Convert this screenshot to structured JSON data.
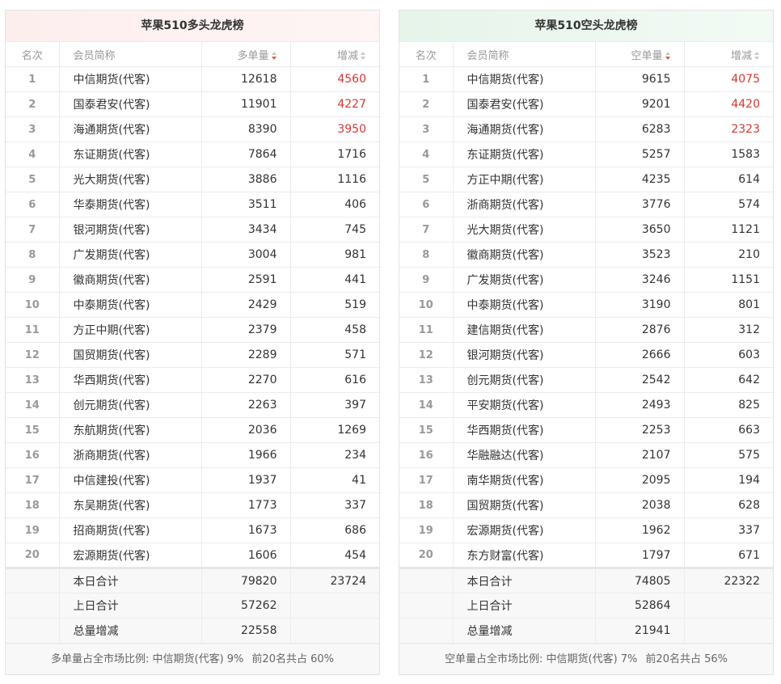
{
  "left": {
    "title": "苹果510多头龙虎榜",
    "headers": {
      "rank": "名次",
      "member": "会员简称",
      "volume": "多单量",
      "change": "增减"
    },
    "rows": [
      {
        "rank": "1",
        "member": "中信期货(代客)",
        "volume": "12618",
        "change": "4560"
      },
      {
        "rank": "2",
        "member": "国泰君安(代客)",
        "volume": "11901",
        "change": "4227"
      },
      {
        "rank": "3",
        "member": "海通期货(代客)",
        "volume": "8390",
        "change": "3950"
      },
      {
        "rank": "4",
        "member": "东证期货(代客)",
        "volume": "7864",
        "change": "1716"
      },
      {
        "rank": "5",
        "member": "光大期货(代客)",
        "volume": "3886",
        "change": "1116"
      },
      {
        "rank": "6",
        "member": "华泰期货(代客)",
        "volume": "3511",
        "change": "406"
      },
      {
        "rank": "7",
        "member": "银河期货(代客)",
        "volume": "3434",
        "change": "745"
      },
      {
        "rank": "8",
        "member": "广发期货(代客)",
        "volume": "3004",
        "change": "981"
      },
      {
        "rank": "9",
        "member": "徽商期货(代客)",
        "volume": "2591",
        "change": "441"
      },
      {
        "rank": "10",
        "member": "中泰期货(代客)",
        "volume": "2429",
        "change": "519"
      },
      {
        "rank": "11",
        "member": "方正中期(代客)",
        "volume": "2379",
        "change": "458"
      },
      {
        "rank": "12",
        "member": "国贸期货(代客)",
        "volume": "2289",
        "change": "571"
      },
      {
        "rank": "13",
        "member": "华西期货(代客)",
        "volume": "2270",
        "change": "616"
      },
      {
        "rank": "14",
        "member": "创元期货(代客)",
        "volume": "2263",
        "change": "397"
      },
      {
        "rank": "15",
        "member": "东航期货(代客)",
        "volume": "2036",
        "change": "1269"
      },
      {
        "rank": "16",
        "member": "浙商期货(代客)",
        "volume": "1966",
        "change": "234"
      },
      {
        "rank": "17",
        "member": "中信建投(代客)",
        "volume": "1937",
        "change": "41"
      },
      {
        "rank": "18",
        "member": "东吴期货(代客)",
        "volume": "1773",
        "change": "337"
      },
      {
        "rank": "19",
        "member": "招商期货(代客)",
        "volume": "1673",
        "change": "686"
      },
      {
        "rank": "20",
        "member": "宏源期货(代客)",
        "volume": "1606",
        "change": "454"
      }
    ],
    "totals": [
      {
        "label": "本日合计",
        "volume": "79820",
        "change": "23724"
      },
      {
        "label": "上日合计",
        "volume": "57262",
        "change": ""
      },
      {
        "label": "总量增减",
        "volume": "22558",
        "change": ""
      }
    ],
    "footer": {
      "ratio": "多单量占全市场比例: 中信期货(代客) 9%",
      "top20": "前20名共占 60%"
    }
  },
  "right": {
    "title": "苹果510空头龙虎榜",
    "headers": {
      "rank": "名次",
      "member": "会员简称",
      "volume": "空单量",
      "change": "增减"
    },
    "rows": [
      {
        "rank": "1",
        "member": "中信期货(代客)",
        "volume": "9615",
        "change": "4075"
      },
      {
        "rank": "2",
        "member": "国泰君安(代客)",
        "volume": "9201",
        "change": "4420"
      },
      {
        "rank": "3",
        "member": "海通期货(代客)",
        "volume": "6283",
        "change": "2323"
      },
      {
        "rank": "4",
        "member": "东证期货(代客)",
        "volume": "5257",
        "change": "1583"
      },
      {
        "rank": "5",
        "member": "方正中期(代客)",
        "volume": "4235",
        "change": "614"
      },
      {
        "rank": "6",
        "member": "浙商期货(代客)",
        "volume": "3776",
        "change": "574"
      },
      {
        "rank": "7",
        "member": "光大期货(代客)",
        "volume": "3650",
        "change": "1121"
      },
      {
        "rank": "8",
        "member": "徽商期货(代客)",
        "volume": "3523",
        "change": "210"
      },
      {
        "rank": "9",
        "member": "广发期货(代客)",
        "volume": "3246",
        "change": "1151"
      },
      {
        "rank": "10",
        "member": "中泰期货(代客)",
        "volume": "3190",
        "change": "801"
      },
      {
        "rank": "11",
        "member": "建信期货(代客)",
        "volume": "2876",
        "change": "312"
      },
      {
        "rank": "12",
        "member": "银河期货(代客)",
        "volume": "2666",
        "change": "603"
      },
      {
        "rank": "13",
        "member": "创元期货(代客)",
        "volume": "2542",
        "change": "642"
      },
      {
        "rank": "14",
        "member": "平安期货(代客)",
        "volume": "2493",
        "change": "825"
      },
      {
        "rank": "15",
        "member": "华西期货(代客)",
        "volume": "2253",
        "change": "663"
      },
      {
        "rank": "16",
        "member": "华融融达(代客)",
        "volume": "2107",
        "change": "575"
      },
      {
        "rank": "17",
        "member": "南华期货(代客)",
        "volume": "2095",
        "change": "194"
      },
      {
        "rank": "18",
        "member": "国贸期货(代客)",
        "volume": "2038",
        "change": "628"
      },
      {
        "rank": "19",
        "member": "宏源期货(代客)",
        "volume": "1962",
        "change": "337"
      },
      {
        "rank": "20",
        "member": "东方财富(代客)",
        "volume": "1797",
        "change": "671"
      }
    ],
    "totals": [
      {
        "label": "本日合计",
        "volume": "74805",
        "change": "22322"
      },
      {
        "label": "上日合计",
        "volume": "52864",
        "change": ""
      },
      {
        "label": "总量增减",
        "volume": "21941",
        "change": ""
      }
    ],
    "footer": {
      "ratio": "空单量占全市场比例: 中信期货(代客) 7%",
      "top20": "前20名共占 56%"
    }
  },
  "colors": {
    "highlight_red": "#d6372f",
    "long_header_bg": "#fdeeee",
    "short_header_bg": "#e6f4ea"
  },
  "icons": {
    "sort_active": "sort-desc-icon",
    "sort_inactive": "sort-icon"
  }
}
